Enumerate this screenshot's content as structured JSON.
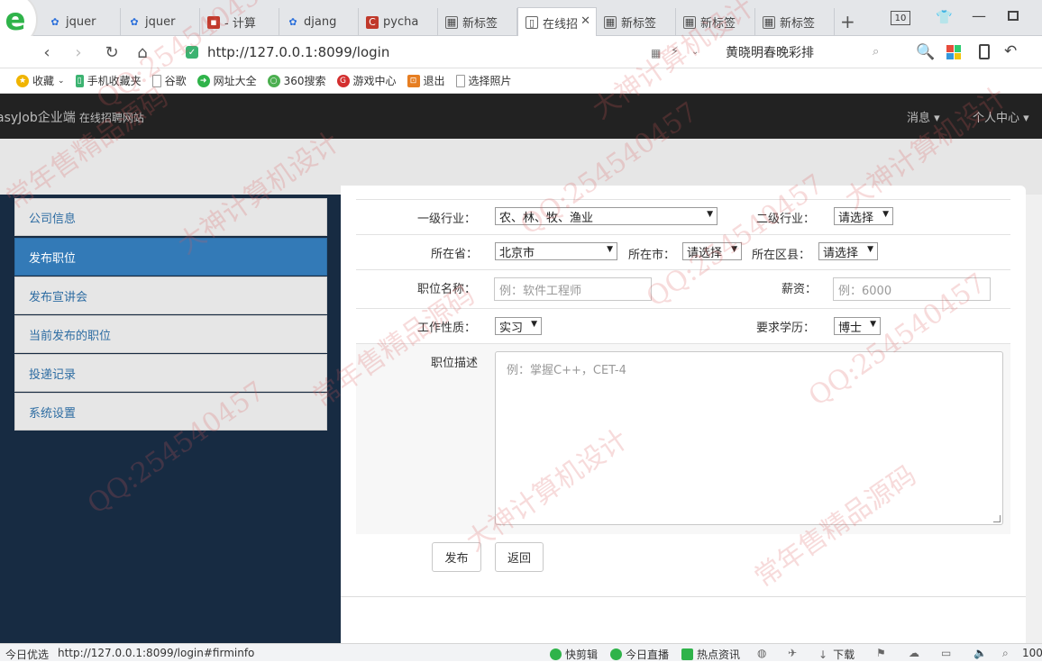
{
  "browser": {
    "tabs": [
      {
        "label": "jquer",
        "icon": "paw-icon",
        "color": "#2a6fdb"
      },
      {
        "label": "jquer",
        "icon": "paw-icon",
        "color": "#2a6fdb"
      },
      {
        "label": "- 计算",
        "icon": "app-icon",
        "color": "#c0392b"
      },
      {
        "label": "djang",
        "icon": "paw-icon",
        "color": "#2a6fdb"
      },
      {
        "label": "pycha",
        "icon": "c-icon",
        "color": "#c0392b"
      },
      {
        "label": "新标签",
        "icon": "grid-icon",
        "color": "#555555"
      },
      {
        "label": "在线招",
        "icon": "page-icon",
        "color": "#555555"
      },
      {
        "label": "新标签",
        "icon": "grid-icon",
        "color": "#555555"
      },
      {
        "label": "新标签",
        "icon": "grid-icon",
        "color": "#555555"
      },
      {
        "label": "新标签",
        "icon": "grid-icon",
        "color": "#555555"
      }
    ],
    "tab_count": "10",
    "url": "http://127.0.0.1:8099/login",
    "search_text": "黄晓明春晚彩排",
    "bookmarks": [
      {
        "label": "收藏",
        "color": "#f0b400"
      },
      {
        "label": "手机收藏夹",
        "color": "#3cb371"
      },
      {
        "label": "谷歌",
        "color": "#9e9e9e"
      },
      {
        "label": "网址大全",
        "color": "#2fb34a"
      },
      {
        "label": "360搜索",
        "color": "#4caf50"
      },
      {
        "label": "游戏中心",
        "color": "#d32f2f"
      },
      {
        "label": "退出",
        "color": "#e67e22"
      },
      {
        "label": "选择照片",
        "color": "#9e9e9e"
      }
    ]
  },
  "header": {
    "brand": "asyJob企业端",
    "subtitle": "在线招聘网站",
    "menu_messages": "消息 ▾",
    "menu_profile": "个人中心 ▾"
  },
  "sidebar": {
    "items": [
      {
        "label": "公司信息"
      },
      {
        "label": "发布职位"
      },
      {
        "label": "发布宣讲会"
      },
      {
        "label": "当前发布的职位"
      },
      {
        "label": "投递记录"
      },
      {
        "label": "系统设置"
      }
    ],
    "active_index": 1
  },
  "form": {
    "industry1_label": "一级行业：",
    "industry1_value": "农、林、牧、渔业",
    "industry2_label": "二级行业：",
    "industry2_value": "请选择",
    "province_label": "所在省：",
    "province_value": "北京市",
    "city_label": "所在市：",
    "city_value": "请选择",
    "district_label": "所在区县：",
    "district_value": "请选择",
    "jobname_label": "职位名称：",
    "jobname_placeholder": "例：软件工程师",
    "salary_label": "薪资：",
    "salary_placeholder": "例：6000",
    "nature_label": "工作性质：",
    "nature_value": "实习",
    "education_label": "要求学历：",
    "education_value": "博士",
    "desc_label": "职位描述",
    "desc_placeholder": "例：掌握C++，CET-4",
    "submit_label": "发布",
    "back_label": "返回"
  },
  "statusbar": {
    "left_label": "今日优选",
    "link_url": "http://127.0.0.1:8099/login#firminfo",
    "items": [
      "快剪辑",
      "今日直播",
      "热点资讯",
      "下载",
      "100"
    ]
  },
  "watermarks": [
    "QQ:254540457",
    "大神计算机设计",
    "常年售精品源码",
    "QQ:254540457",
    "大神计算机设计",
    "常年售精品源码",
    "QQ:254540457",
    "大神计算机设计",
    "QQ:254540457",
    "常年售精品源码",
    "QQ:254540457",
    "大神计算机设计"
  ]
}
